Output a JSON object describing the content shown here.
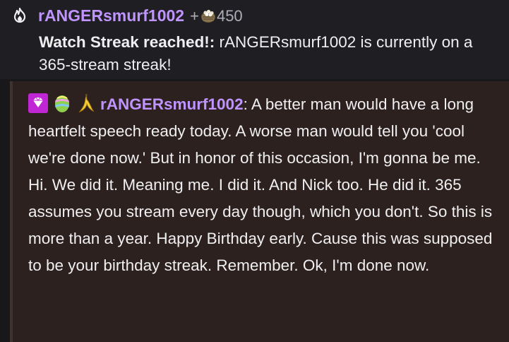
{
  "event": {
    "icon": "flame-streak-icon",
    "username": "rANGERsmurf1002",
    "points_prefix": "+",
    "points_icon": "channel-points-icon",
    "points_value": "450",
    "title": "Watch Streak reached!:",
    "description": " rANGERsmurf1002 is currently on a 365-stream streak!"
  },
  "message": {
    "badges": [
      "sub-gem-badge-icon",
      "easter-egg-badge-icon",
      "banana-badge-icon"
    ],
    "username": "rANGERsmurf1002",
    "separator": ": ",
    "text": "A better man would have a long heartfelt speech ready today. A worse man would tell you 'cool we're done now.' But in honor of this occasion, I'm gonna be me. Hi. We did it. Meaning me. I did it. And Nick too. He did it. 365 assumes you stream every day though, which you don't. So this is more than a year. Happy Birthday early. Cause this was supposed to be your birthday streak. Remember. Ok, I'm done now."
  },
  "colors": {
    "username": "#bf94ff",
    "text": "#efeff1",
    "muted": "#adadb8",
    "event_bg": "#1f1f23",
    "message_bg": "#2d211f"
  }
}
